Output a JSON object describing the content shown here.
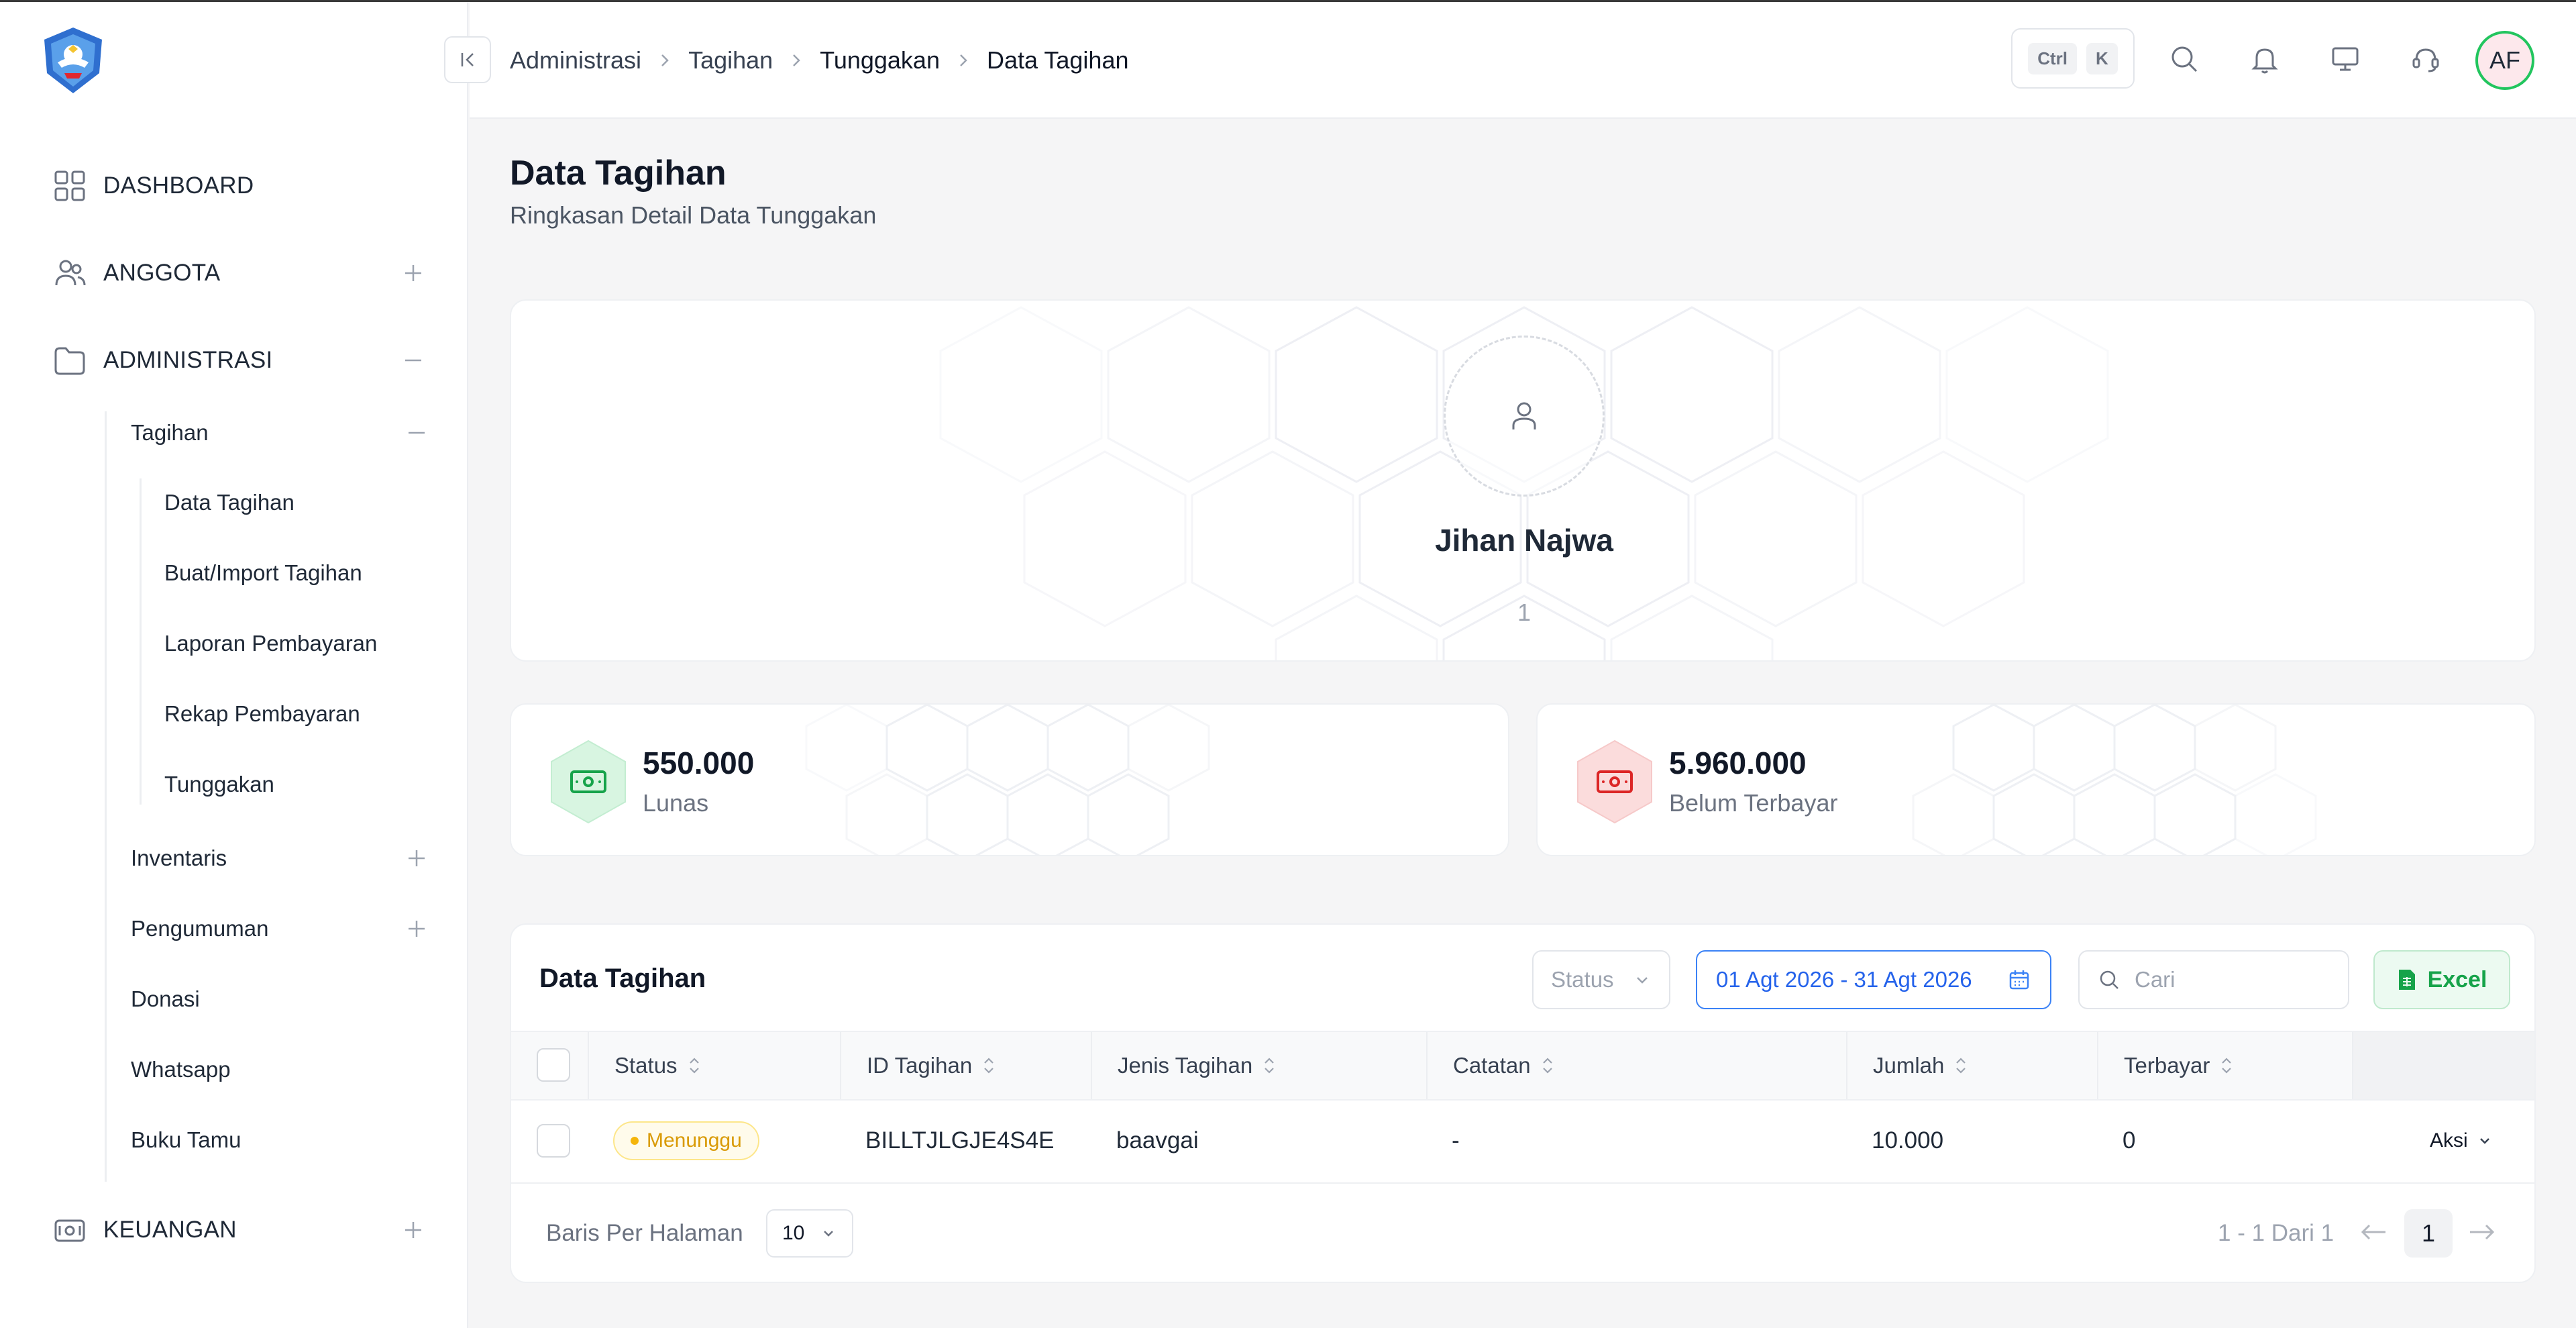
{
  "sidebar": {
    "logo": "tut-wuri-handayani-logo",
    "items": [
      {
        "label": "DASHBOARD",
        "icon": "grid-icon"
      },
      {
        "label": "ANGGOTA",
        "icon": "users-icon"
      },
      {
        "label": "ADMINISTRASI",
        "icon": "folder-icon"
      },
      {
        "label": "KEUANGAN",
        "icon": "wallet-icon"
      }
    ],
    "sub": {
      "tagihan": "Tagihan",
      "inventaris": "Inventaris",
      "pengumuman": "Pengumuman",
      "donasi": "Donasi",
      "whatsapp": "Whatsapp",
      "buku_tamu": "Buku Tamu"
    },
    "tagihan_items": [
      "Data Tagihan",
      "Buat/Import Tagihan",
      "Laporan Pembayaran",
      "Rekap Pembayaran",
      "Tunggakan"
    ]
  },
  "header": {
    "breadcrumb": [
      "Administrasi",
      "Tagihan",
      "Tunggakan",
      "Data Tagihan"
    ],
    "kbd": [
      "Ctrl",
      "K"
    ],
    "avatar_initials": "AF",
    "accent": "#22c55e"
  },
  "page": {
    "title": "Data Tagihan",
    "subtitle": "Ringkasan Detail Data Tunggakan"
  },
  "profile": {
    "name": "Jihan Najwa",
    "id": "1"
  },
  "stats": {
    "lunas": {
      "value": "550.000",
      "label": "Lunas",
      "color": "#16a34a"
    },
    "belum": {
      "value": "5.960.000",
      "label": "Belum Terbayar",
      "color": "#dc2626"
    }
  },
  "table": {
    "title": "Data Tagihan",
    "status_filter": "Status",
    "date_range": "01 Agt 2026 - 31 Agt 2026",
    "search_placeholder": "Cari",
    "excel_label": "Excel",
    "columns": [
      "Status",
      "ID Tagihan",
      "Jenis Tagihan",
      "Catatan",
      "Jumlah",
      "Terbayar"
    ],
    "rows": [
      {
        "status": "Menunggu",
        "id": "BILLTJLGJE4S4E",
        "jenis": "baavgai",
        "catatan": "-",
        "jumlah": "10.000",
        "terbayar": "0",
        "aksi": "Aksi"
      }
    ],
    "footer": {
      "per_page_label": "Baris Per Halaman",
      "per_page_value": "10",
      "page_info": "1 - 1 Dari 1",
      "current_page": "1"
    }
  }
}
